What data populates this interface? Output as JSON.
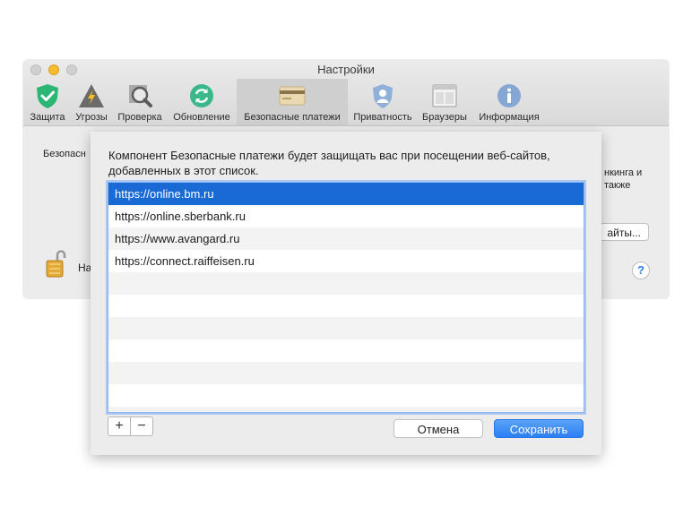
{
  "window": {
    "title": "Настройки",
    "accent": "#1a6ad6"
  },
  "toolbar": {
    "tabs": [
      {
        "label": "Защита",
        "icon": "shield-check-icon"
      },
      {
        "label": "Угрозы",
        "icon": "warning-triangle-icon"
      },
      {
        "label": "Проверка",
        "icon": "scan-magnifier-icon"
      },
      {
        "label": "Обновление",
        "icon": "update-refresh-icon"
      },
      {
        "label": "Безопасные платежи",
        "icon": "credit-card-icon",
        "selected": true
      },
      {
        "label": "Приватность",
        "icon": "privacy-person-icon"
      },
      {
        "label": "Браузеры",
        "icon": "browser-window-icon"
      },
      {
        "label": "Информация",
        "icon": "info-icon"
      }
    ]
  },
  "background": {
    "section_text": "Безопасн",
    "right_line1": "нкинга и",
    "right_line2": "также",
    "sites_button": "айты...",
    "lock_text": "На",
    "help_label": "?"
  },
  "sheet": {
    "message": "Компонент Безопасные платежи будет защищать вас при посещении веб-сайтов, добавленных в этот список.",
    "sites": [
      "https://online.bm.ru",
      "https://online.sberbank.ru",
      "https://www.avangard.ru",
      "https://connect.raiffeisen.ru"
    ],
    "selected_index": 0,
    "add_label": "+",
    "remove_label": "−",
    "cancel_label": "Отмена",
    "save_label": "Сохранить"
  }
}
